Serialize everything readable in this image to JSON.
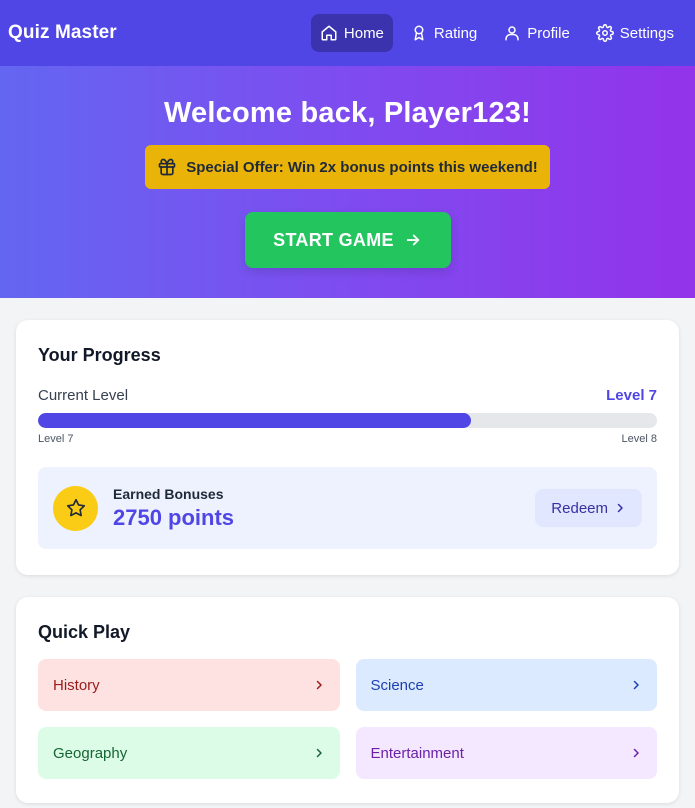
{
  "app": {
    "title": "Quiz Master"
  },
  "nav": {
    "items": [
      {
        "label": "Home",
        "icon": "home-icon",
        "active": true
      },
      {
        "label": "Rating",
        "icon": "award-icon"
      },
      {
        "label": "Profile",
        "icon": "user-icon"
      },
      {
        "label": "Settings",
        "icon": "gear-icon"
      }
    ]
  },
  "hero": {
    "title": "Welcome back, Player123!",
    "offer": "Special Offer: Win 2x bonus points this weekend!",
    "start_label": "START GAME"
  },
  "progress": {
    "title": "Your Progress",
    "current_level_label": "Current Level",
    "current_level_value": "Level 7",
    "fill_fraction": 0.7,
    "bar_left_label": "Level 7",
    "bar_right_label": "Level 8",
    "bonus_label": "Earned Bonuses",
    "bonus_points": "2750 points",
    "redeem_label": "Redeem"
  },
  "quick_play": {
    "title": "Quick Play",
    "categories": [
      {
        "label": "History"
      },
      {
        "label": "Science"
      },
      {
        "label": "Geography"
      },
      {
        "label": "Entertainment"
      }
    ]
  },
  "colors": {
    "primary": "#4f46e5",
    "offer": "#eab308",
    "start": "#22c55e",
    "star": "#facc15"
  }
}
